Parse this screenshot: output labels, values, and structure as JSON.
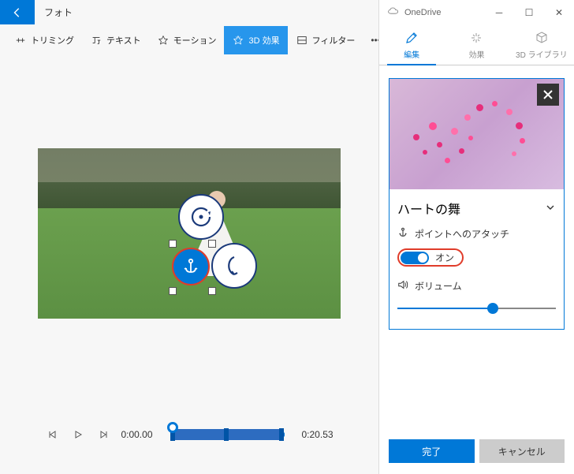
{
  "app": {
    "title": "フォト"
  },
  "toolbar": {
    "trimming": "トリミング",
    "text": "テキスト",
    "motion": "モーション",
    "fx3d": "3D 効果",
    "filter": "フィルター"
  },
  "player": {
    "current": "0:00.00",
    "duration": "0:20.53"
  },
  "onedrive": "OneDrive",
  "right_tabs": {
    "edit": "編集",
    "effects": "効果",
    "library": "3D ライブラリ"
  },
  "effect": {
    "title": "ハートの舞",
    "attach_label": "ポイントへのアタッチ",
    "toggle_label": "オン",
    "volume_label": "ボリューム",
    "volume_percent": 60
  },
  "footer": {
    "done": "完了",
    "cancel": "キャンセル"
  }
}
